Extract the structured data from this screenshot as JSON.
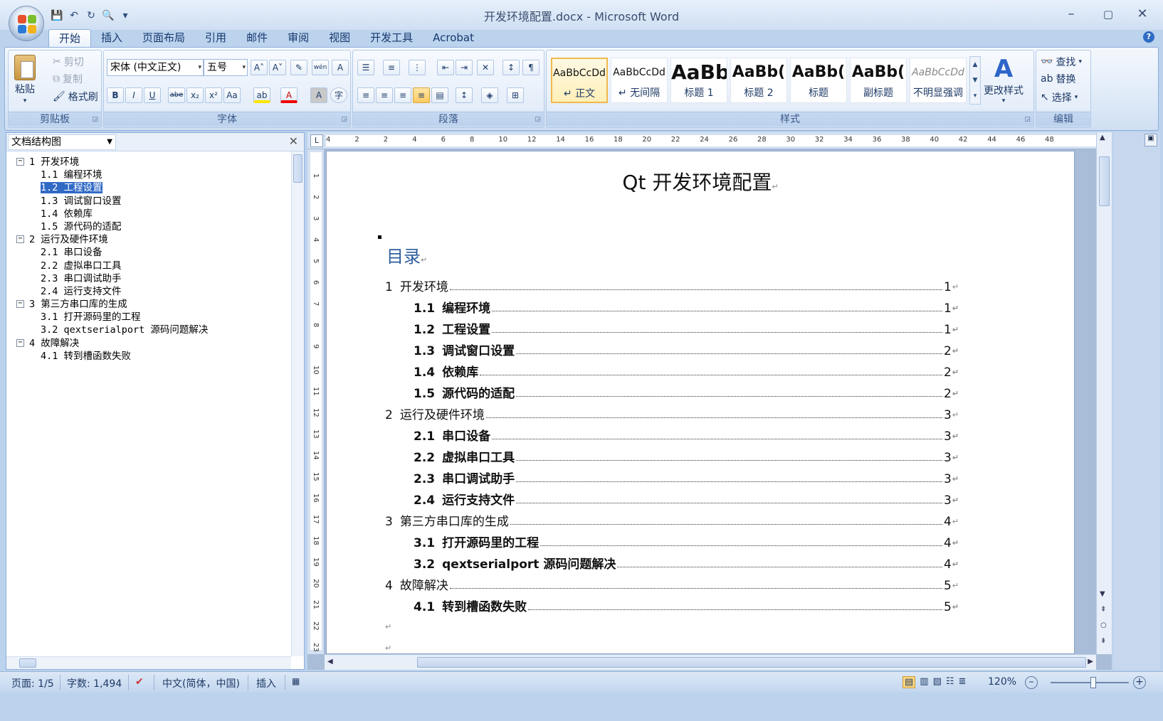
{
  "window": {
    "title": "开发环境配置.docx - Microsoft Word",
    "min": "–",
    "max": "▢",
    "close": "✕"
  },
  "qat": {
    "save": "💾",
    "undo": "↶",
    "redo": "↻",
    "preview": "🔍",
    "more": "▾"
  },
  "tabs": [
    "开始",
    "插入",
    "页面布局",
    "引用",
    "邮件",
    "审阅",
    "视图",
    "开发工具",
    "Acrobat"
  ],
  "ribbon": {
    "clipboard": {
      "label": "剪贴板",
      "paste": "粘贴",
      "cut": "剪切",
      "copy": "复制",
      "format_painter": "格式刷"
    },
    "font": {
      "label": "字体",
      "font_name": "宋体 (中文正文)",
      "font_size": "五号",
      "bold": "B",
      "italic": "I",
      "underline": "U",
      "strike": "abe",
      "sub": "x₂",
      "sup": "x²",
      "case": "Aa",
      "grow": "A˄",
      "shrink": "A˅",
      "clear": "✎",
      "phonetic": "wén",
      "border": "A",
      "highlight": "ab",
      "color": "A",
      "shade": "A",
      "enclose": "字"
    },
    "paragraph": {
      "label": "段落"
    },
    "styles": {
      "label": "样式",
      "items": [
        {
          "sample": "AaBbCcDd",
          "name": "↵ 正文"
        },
        {
          "sample": "AaBbCcDd",
          "name": "↵ 无间隔"
        },
        {
          "sample": "AaBb",
          "name": "标题 1"
        },
        {
          "sample": "AaBb(",
          "name": "标题 2"
        },
        {
          "sample": "AaBb(",
          "name": "标题"
        },
        {
          "sample": "AaBb(",
          "name": "副标题"
        },
        {
          "sample": "AaBbCcDd",
          "name": "不明显强调"
        }
      ],
      "change": "更改样式"
    },
    "editing": {
      "label": "编辑",
      "find": "查找",
      "replace": "替换",
      "select": "选择"
    }
  },
  "nav": {
    "title": "文档结构图",
    "close": "✕",
    "tree": [
      {
        "level": 1,
        "text": "1 开发环境"
      },
      {
        "level": 2,
        "text": "1.1 编程环境"
      },
      {
        "level": 2,
        "text": "1.2 工程设置",
        "selected": true
      },
      {
        "level": 2,
        "text": "1.3 调试窗口设置"
      },
      {
        "level": 2,
        "text": "1.4 依赖库"
      },
      {
        "level": 2,
        "text": "1.5 源代码的适配"
      },
      {
        "level": 1,
        "text": "2 运行及硬件环境"
      },
      {
        "level": 2,
        "text": "2.1 串口设备"
      },
      {
        "level": 2,
        "text": "2.2 虚拟串口工具"
      },
      {
        "level": 2,
        "text": "2.3 串口调试助手"
      },
      {
        "level": 2,
        "text": "2.4 运行支持文件"
      },
      {
        "level": 1,
        "text": "3 第三方串口库的生成"
      },
      {
        "level": 2,
        "text": "3.1 打开源码里的工程"
      },
      {
        "level": 2,
        "text": "3.2 qextserialport 源码问题解决"
      },
      {
        "level": 1,
        "text": "4 故障解决"
      },
      {
        "level": 2,
        "text": "4.1 转到槽函数失败"
      }
    ]
  },
  "ruler": {
    "h_ticks": [
      "4",
      "2",
      "2",
      "4",
      "6",
      "8",
      "10",
      "12",
      "14",
      "16",
      "18",
      "20",
      "22",
      "24",
      "26",
      "28",
      "30",
      "32",
      "34",
      "36",
      "38",
      "40",
      "42",
      "44",
      "46",
      "48"
    ],
    "v_ticks": [
      "1",
      "2",
      "3",
      "4",
      "5",
      "6",
      "7",
      "8",
      "9",
      "10",
      "11",
      "12",
      "13",
      "14",
      "15",
      "16",
      "17",
      "18",
      "19",
      "20",
      "21",
      "22",
      "23"
    ]
  },
  "doc": {
    "title": "Qt 开发环境配置",
    "toc_heading": "目录",
    "pilcrow": "↵",
    "toc": [
      {
        "level": 1,
        "num": "1",
        "text": "开发环境",
        "page": "1"
      },
      {
        "level": 2,
        "num": "1.1",
        "text": "编程环境",
        "page": "1"
      },
      {
        "level": 2,
        "num": "1.2",
        "text": "工程设置",
        "page": "1"
      },
      {
        "level": 2,
        "num": "1.3",
        "text": "调试窗口设置",
        "page": "2"
      },
      {
        "level": 2,
        "num": "1.4",
        "text": "依赖库",
        "page": "2"
      },
      {
        "level": 2,
        "num": "1.5",
        "text": "源代码的适配",
        "page": "2"
      },
      {
        "level": 1,
        "num": "2",
        "text": "运行及硬件环境",
        "page": "3"
      },
      {
        "level": 2,
        "num": "2.1",
        "text": "串口设备",
        "page": "3"
      },
      {
        "level": 2,
        "num": "2.2",
        "text": "虚拟串口工具",
        "page": "3"
      },
      {
        "level": 2,
        "num": "2.3",
        "text": "串口调试助手",
        "page": "3"
      },
      {
        "level": 2,
        "num": "2.4",
        "text": "运行支持文件",
        "page": "3"
      },
      {
        "level": 1,
        "num": "3",
        "text": "第三方串口库的生成",
        "page": "4"
      },
      {
        "level": 2,
        "num": "3.1",
        "text": "打开源码里的工程",
        "page": "4"
      },
      {
        "level": 2,
        "num": "3.2",
        "text": "qextserialport 源码问题解决",
        "page": "4"
      },
      {
        "level": 1,
        "num": "4",
        "text": "故障解决",
        "page": "5"
      },
      {
        "level": 2,
        "num": "4.1",
        "text": "转到槽函数失败",
        "page": "5"
      }
    ]
  },
  "status": {
    "page": "页面: 1/5",
    "words": "字数: 1,494",
    "language": "中文(简体，中国)",
    "mode": "插入",
    "zoom": "120%"
  },
  "colors": {
    "accent": "#316ac5",
    "toc_heading": "#2c5d9e"
  }
}
